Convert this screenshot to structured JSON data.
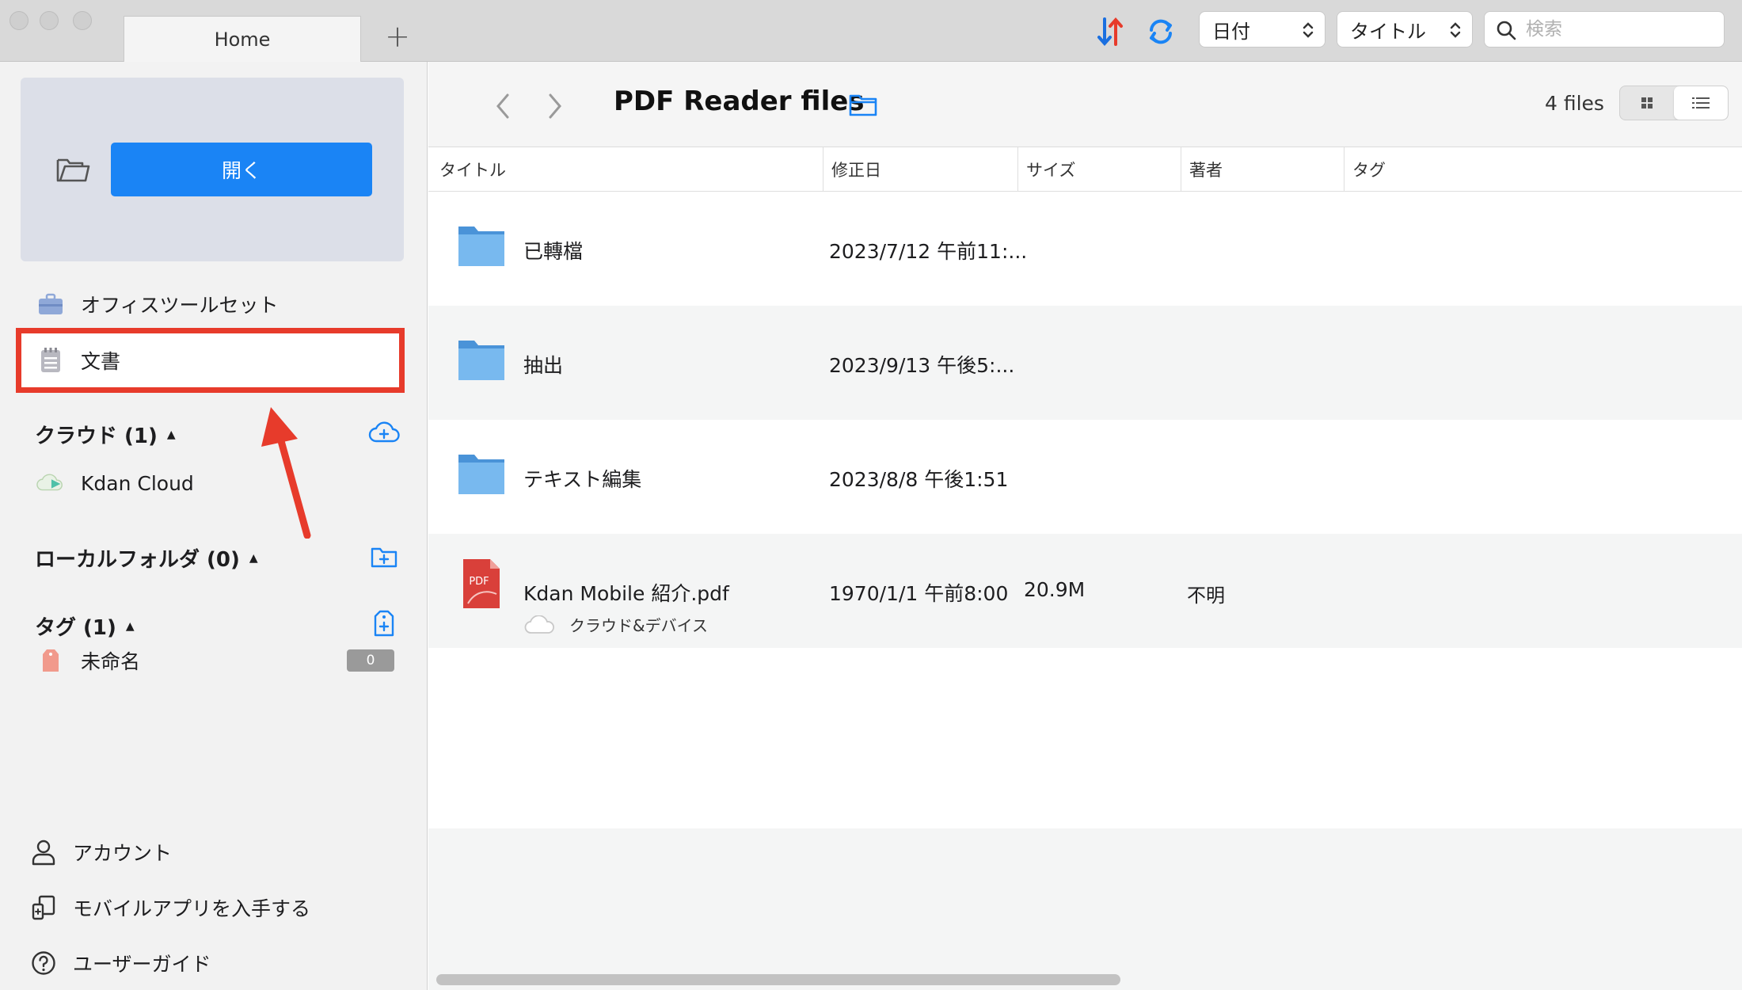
{
  "window": {
    "tabs": [
      {
        "label": "Home"
      }
    ],
    "add_tab_label": "+"
  },
  "toolbar": {
    "sort_select": {
      "value": "日付",
      "options": [
        "日付"
      ]
    },
    "title_select": {
      "value": "タイトル",
      "options": [
        "タイトル"
      ]
    },
    "search": {
      "placeholder": "検索",
      "value": ""
    }
  },
  "sidebar": {
    "open_button_label": "開く",
    "items": [
      {
        "label": "オフィスツールセット",
        "icon": "briefcase-icon"
      },
      {
        "label": "文書",
        "icon": "document-icon",
        "highlighted": true
      }
    ],
    "cloud": {
      "header": "クラウド (1)",
      "items": [
        {
          "label": "Kdan Cloud",
          "icon": "kdan-cloud-icon"
        }
      ]
    },
    "local": {
      "header": "ローカルフォルダ (0)"
    },
    "tags": {
      "header": "タグ (1)",
      "items": [
        {
          "label": "未命名",
          "count": "0"
        }
      ]
    },
    "bottom": [
      {
        "label": "アカウント",
        "icon": "user-icon"
      },
      {
        "label": "モバイルアプリを入手する",
        "icon": "mobile-app-icon"
      },
      {
        "label": "ユーザーガイド",
        "icon": "help-icon"
      }
    ]
  },
  "main": {
    "title": "PDF Reader files",
    "file_count": "4 files",
    "columns": [
      "タイトル",
      "修正日",
      "サイズ",
      "著者",
      "タグ"
    ],
    "rows": [
      {
        "name": "已轉檔",
        "date": "2023/7/12 午前11:...",
        "size": "",
        "author": "",
        "type": "folder"
      },
      {
        "name": "抽出",
        "date": "2023/9/13 午後5:...",
        "size": "",
        "author": "",
        "type": "folder"
      },
      {
        "name": "テキスト編集",
        "date": "2023/8/8 午後1:51",
        "size": "",
        "author": "",
        "type": "folder"
      },
      {
        "name": "Kdan Mobile 紹介.pdf",
        "date": "1970/1/1 午前8:00",
        "size": "20.9M",
        "author": "不明",
        "type": "pdf",
        "location": "クラウド&デバイス",
        "icon_label": "PDF"
      }
    ]
  },
  "colors": {
    "accent": "#1a84f5",
    "highlight": "#e73b2b",
    "folder": "#5aa6e8",
    "pdf": "#d9403a"
  }
}
